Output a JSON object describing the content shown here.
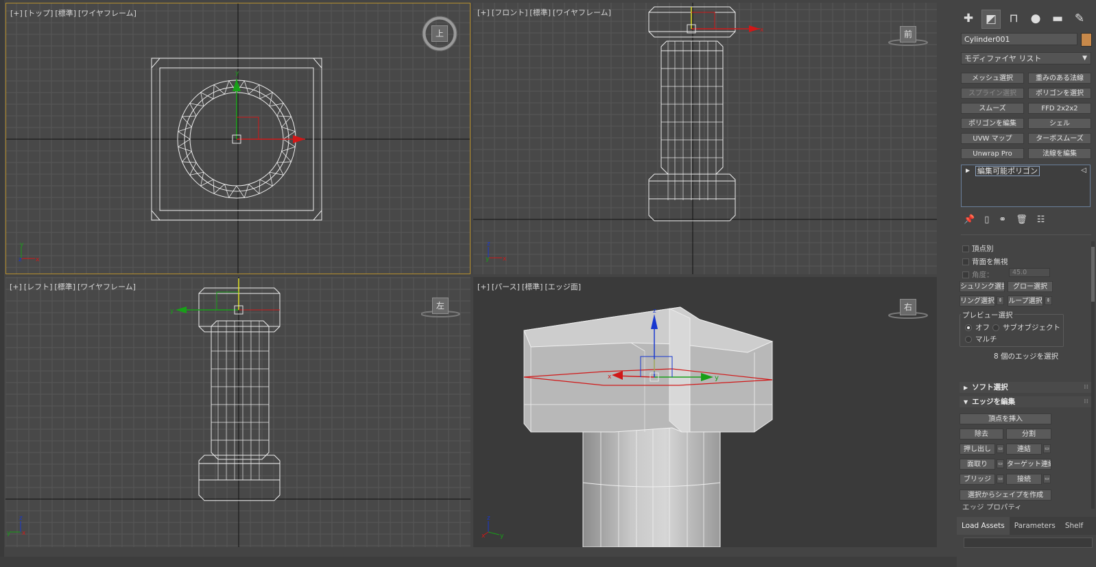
{
  "viewports": {
    "top": {
      "plus": "[+]",
      "view": "[トップ]",
      "mode": "[標準]",
      "shading": "[ワイヤフレーム]",
      "cube_face": "上"
    },
    "front": {
      "plus": "[+]",
      "view": "[フロント]",
      "mode": "[標準]",
      "shading": "[ワイヤフレーム]",
      "cube_face": "前"
    },
    "left": {
      "plus": "[+]",
      "view": "[レフト]",
      "mode": "[標準]",
      "shading": "[ワイヤフレーム]",
      "cube_face": "左"
    },
    "persp": {
      "plus": "[+]",
      "view": "[パース]",
      "mode": "[標準]",
      "shading": "[エッジ面]",
      "cube_face": "右"
    }
  },
  "axis_labels": {
    "x": "x",
    "y": "y",
    "z": "z"
  },
  "colors": {
    "x_axis": "#d01818",
    "y_axis": "#18a018",
    "z_axis": "#1838d0",
    "active_border": "#b8902e",
    "object_color": "#c8894a"
  },
  "command_panel": {
    "tab_icons": [
      "create-icon",
      "modify-icon",
      "hierarchy-icon",
      "motion-icon",
      "display-icon",
      "utilities-icon"
    ],
    "object_name": "Cylinder001",
    "modifier_list": "モディファイヤ リスト",
    "modifier_buttons": [
      {
        "label": "メッシュ選択",
        "enabled": true
      },
      {
        "label": "重みのある法線",
        "enabled": true
      },
      {
        "label": "スプライン選択",
        "enabled": false
      },
      {
        "label": "ポリゴンを選択",
        "enabled": true
      },
      {
        "label": "スムーズ",
        "enabled": true
      },
      {
        "label": "FFD 2x2x2",
        "enabled": true
      },
      {
        "label": "ポリゴンを編集",
        "enabled": true
      },
      {
        "label": "シェル",
        "enabled": true
      },
      {
        "label": "UVW マップ",
        "enabled": true
      },
      {
        "label": "ターボスムーズ",
        "enabled": true
      },
      {
        "label": "Unwrap Pro",
        "enabled": true
      },
      {
        "label": "法線を編集",
        "enabled": true
      }
    ],
    "stack_item": "編集可能ポリゴン",
    "selection": {
      "by_vertex": "頂点別",
      "ignore_backfacing": "背面を無視",
      "angle_label": "角度：",
      "angle_value": "45.0",
      "shrink": "シュリンク選択",
      "grow": "グロー選択",
      "ring": "リング選択",
      "loop": "ループ選択",
      "preview_title": "プレビュー選択",
      "preview_off": "オフ",
      "preview_subobject": "サブオブジェクト",
      "preview_multi": "マルチ",
      "status": "8 個のエッジを選択"
    },
    "soft_selection": "ソフト選択",
    "edit_edges": {
      "title": "エッジを編集",
      "insert_vertex": "頂点を挿入",
      "remove": "除去",
      "split": "分割",
      "extrude": "押し出し",
      "weld": "連結",
      "chamfer": "面取り",
      "target_weld": "ターゲット連結",
      "bridge": "ブリッジ",
      "connect": "接続",
      "create_shape": "選択からシェイプを作成",
      "edge_properties": "エッジ プロパティ"
    },
    "bottom_tabs": [
      "Load Assets",
      "Parameters",
      "Shelf"
    ]
  }
}
